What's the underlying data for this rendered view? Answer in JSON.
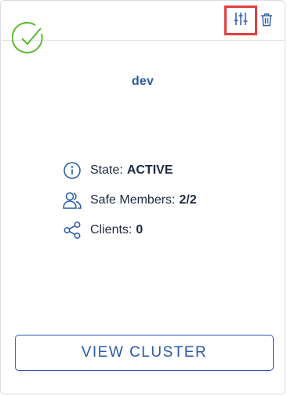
{
  "colors": {
    "accent": "#2a5aa8",
    "status_ok": "#5bb82a",
    "highlight_border": "#e04040",
    "text": "#1c2940"
  },
  "card": {
    "status_icon": "check-circle-icon",
    "toolbar": {
      "settings_icon": "sliders-icon",
      "delete_icon": "trash-icon"
    },
    "cluster_name": "dev",
    "info": {
      "state": {
        "icon": "info-icon",
        "label": "State:",
        "value": "ACTIVE"
      },
      "safe_members": {
        "icon": "users-icon",
        "label": "Safe Members:",
        "value": "2/2"
      },
      "clients": {
        "icon": "share-icon",
        "label": "Clients:",
        "value": "0"
      }
    },
    "view_button_label": "VIEW CLUSTER"
  }
}
